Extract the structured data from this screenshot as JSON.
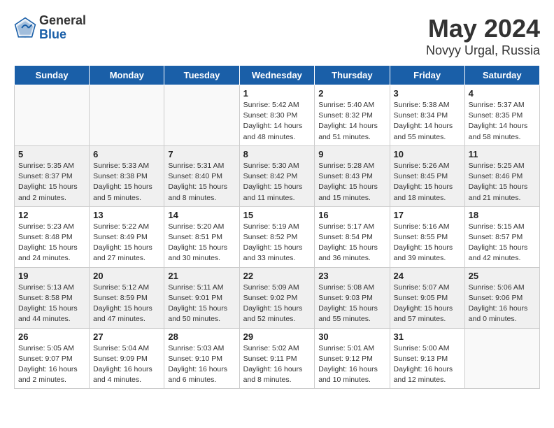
{
  "header": {
    "logo_general": "General",
    "logo_blue": "Blue",
    "month": "May 2024",
    "location": "Novyy Urgal, Russia"
  },
  "days_of_week": [
    "Sunday",
    "Monday",
    "Tuesday",
    "Wednesday",
    "Thursday",
    "Friday",
    "Saturday"
  ],
  "weeks": [
    [
      {
        "num": "",
        "info": ""
      },
      {
        "num": "",
        "info": ""
      },
      {
        "num": "",
        "info": ""
      },
      {
        "num": "1",
        "info": "Sunrise: 5:42 AM\nSunset: 8:30 PM\nDaylight: 14 hours\nand 48 minutes."
      },
      {
        "num": "2",
        "info": "Sunrise: 5:40 AM\nSunset: 8:32 PM\nDaylight: 14 hours\nand 51 minutes."
      },
      {
        "num": "3",
        "info": "Sunrise: 5:38 AM\nSunset: 8:34 PM\nDaylight: 14 hours\nand 55 minutes."
      },
      {
        "num": "4",
        "info": "Sunrise: 5:37 AM\nSunset: 8:35 PM\nDaylight: 14 hours\nand 58 minutes."
      }
    ],
    [
      {
        "num": "5",
        "info": "Sunrise: 5:35 AM\nSunset: 8:37 PM\nDaylight: 15 hours\nand 2 minutes."
      },
      {
        "num": "6",
        "info": "Sunrise: 5:33 AM\nSunset: 8:38 PM\nDaylight: 15 hours\nand 5 minutes."
      },
      {
        "num": "7",
        "info": "Sunrise: 5:31 AM\nSunset: 8:40 PM\nDaylight: 15 hours\nand 8 minutes."
      },
      {
        "num": "8",
        "info": "Sunrise: 5:30 AM\nSunset: 8:42 PM\nDaylight: 15 hours\nand 11 minutes."
      },
      {
        "num": "9",
        "info": "Sunrise: 5:28 AM\nSunset: 8:43 PM\nDaylight: 15 hours\nand 15 minutes."
      },
      {
        "num": "10",
        "info": "Sunrise: 5:26 AM\nSunset: 8:45 PM\nDaylight: 15 hours\nand 18 minutes."
      },
      {
        "num": "11",
        "info": "Sunrise: 5:25 AM\nSunset: 8:46 PM\nDaylight: 15 hours\nand 21 minutes."
      }
    ],
    [
      {
        "num": "12",
        "info": "Sunrise: 5:23 AM\nSunset: 8:48 PM\nDaylight: 15 hours\nand 24 minutes."
      },
      {
        "num": "13",
        "info": "Sunrise: 5:22 AM\nSunset: 8:49 PM\nDaylight: 15 hours\nand 27 minutes."
      },
      {
        "num": "14",
        "info": "Sunrise: 5:20 AM\nSunset: 8:51 PM\nDaylight: 15 hours\nand 30 minutes."
      },
      {
        "num": "15",
        "info": "Sunrise: 5:19 AM\nSunset: 8:52 PM\nDaylight: 15 hours\nand 33 minutes."
      },
      {
        "num": "16",
        "info": "Sunrise: 5:17 AM\nSunset: 8:54 PM\nDaylight: 15 hours\nand 36 minutes."
      },
      {
        "num": "17",
        "info": "Sunrise: 5:16 AM\nSunset: 8:55 PM\nDaylight: 15 hours\nand 39 minutes."
      },
      {
        "num": "18",
        "info": "Sunrise: 5:15 AM\nSunset: 8:57 PM\nDaylight: 15 hours\nand 42 minutes."
      }
    ],
    [
      {
        "num": "19",
        "info": "Sunrise: 5:13 AM\nSunset: 8:58 PM\nDaylight: 15 hours\nand 44 minutes."
      },
      {
        "num": "20",
        "info": "Sunrise: 5:12 AM\nSunset: 8:59 PM\nDaylight: 15 hours\nand 47 minutes."
      },
      {
        "num": "21",
        "info": "Sunrise: 5:11 AM\nSunset: 9:01 PM\nDaylight: 15 hours\nand 50 minutes."
      },
      {
        "num": "22",
        "info": "Sunrise: 5:09 AM\nSunset: 9:02 PM\nDaylight: 15 hours\nand 52 minutes."
      },
      {
        "num": "23",
        "info": "Sunrise: 5:08 AM\nSunset: 9:03 PM\nDaylight: 15 hours\nand 55 minutes."
      },
      {
        "num": "24",
        "info": "Sunrise: 5:07 AM\nSunset: 9:05 PM\nDaylight: 15 hours\nand 57 minutes."
      },
      {
        "num": "25",
        "info": "Sunrise: 5:06 AM\nSunset: 9:06 PM\nDaylight: 16 hours\nand 0 minutes."
      }
    ],
    [
      {
        "num": "26",
        "info": "Sunrise: 5:05 AM\nSunset: 9:07 PM\nDaylight: 16 hours\nand 2 minutes."
      },
      {
        "num": "27",
        "info": "Sunrise: 5:04 AM\nSunset: 9:09 PM\nDaylight: 16 hours\nand 4 minutes."
      },
      {
        "num": "28",
        "info": "Sunrise: 5:03 AM\nSunset: 9:10 PM\nDaylight: 16 hours\nand 6 minutes."
      },
      {
        "num": "29",
        "info": "Sunrise: 5:02 AM\nSunset: 9:11 PM\nDaylight: 16 hours\nand 8 minutes."
      },
      {
        "num": "30",
        "info": "Sunrise: 5:01 AM\nSunset: 9:12 PM\nDaylight: 16 hours\nand 10 minutes."
      },
      {
        "num": "31",
        "info": "Sunrise: 5:00 AM\nSunset: 9:13 PM\nDaylight: 16 hours\nand 12 minutes."
      },
      {
        "num": "",
        "info": ""
      }
    ]
  ]
}
